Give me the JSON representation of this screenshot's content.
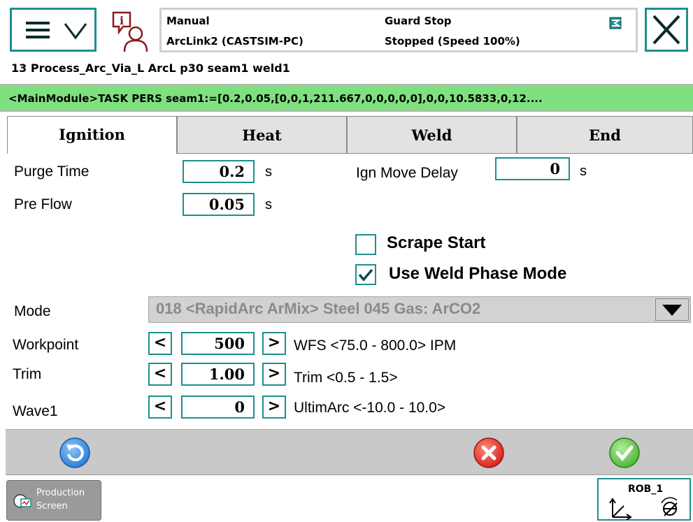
{
  "header": {
    "mode": "Manual",
    "controller": "ArcLink2 (CASTSIM-PC)",
    "guard": "Guard Stop",
    "run_state": "Stopped (Speed 100%)"
  },
  "routine_line": "13 Process_Arc_Via_L ArcL p30 seam1 weld1",
  "pers_line": "<MainModule>TASK  PERS  seam1:=[0.2,0.05,[0,0,1,211.667,0,0,0,0,0],0,0,10.5833,0,12....",
  "tabs": [
    {
      "label": "Ignition",
      "active": true
    },
    {
      "label": "Heat",
      "active": false
    },
    {
      "label": "Weld",
      "active": false
    },
    {
      "label": "End",
      "active": false
    }
  ],
  "fields": {
    "purge_time": {
      "label": "Purge Time",
      "value": "0.2",
      "unit": "s"
    },
    "pre_flow": {
      "label": "Pre Flow",
      "value": "0.05",
      "unit": "s"
    },
    "ign_move_delay": {
      "label": "Ign Move Delay",
      "value": "0",
      "unit": "s"
    }
  },
  "checkboxes": {
    "scrape_start": {
      "label": "Scrape Start",
      "checked": false
    },
    "use_weld_phase_mode": {
      "label": "Use Weld Phase Mode",
      "checked": true
    }
  },
  "mode": {
    "label": "Mode",
    "selected": "018 <RapidArc  ArMix> Steel 045 Gas: ArCO2"
  },
  "steppers": {
    "workpoint": {
      "label": "Workpoint",
      "value": "500",
      "range": "WFS <75.0 - 800.0> IPM",
      "dec": "<",
      "inc": ">"
    },
    "trim": {
      "label": "Trim",
      "value": "1.00",
      "range": "Trim <0.5 - 1.5>",
      "dec": "<",
      "inc": ">"
    },
    "wave1": {
      "label": "Wave1",
      "value": "0",
      "range": "UltimArc <-10.0 - 10.0>",
      "dec": "<",
      "inc": ">"
    }
  },
  "taskbar": {
    "production_line1": "Production",
    "production_line2": "Screen",
    "robot": "ROB_1"
  },
  "colors": {
    "accent": "#1e8f8f",
    "pers_bar": "#7fe07f",
    "cancel": "#d7261e",
    "ok": "#4fb83a",
    "refresh": "#2f7fd6"
  },
  "icons": {
    "menu": "hamburger-menu-icon",
    "info": "event-log-icon",
    "close": "close-icon",
    "refresh": "refresh-icon",
    "cancel": "cancel-icon",
    "ok": "ok-icon",
    "production": "production-screen-icon",
    "jog": "jog-coordinates-icon"
  }
}
